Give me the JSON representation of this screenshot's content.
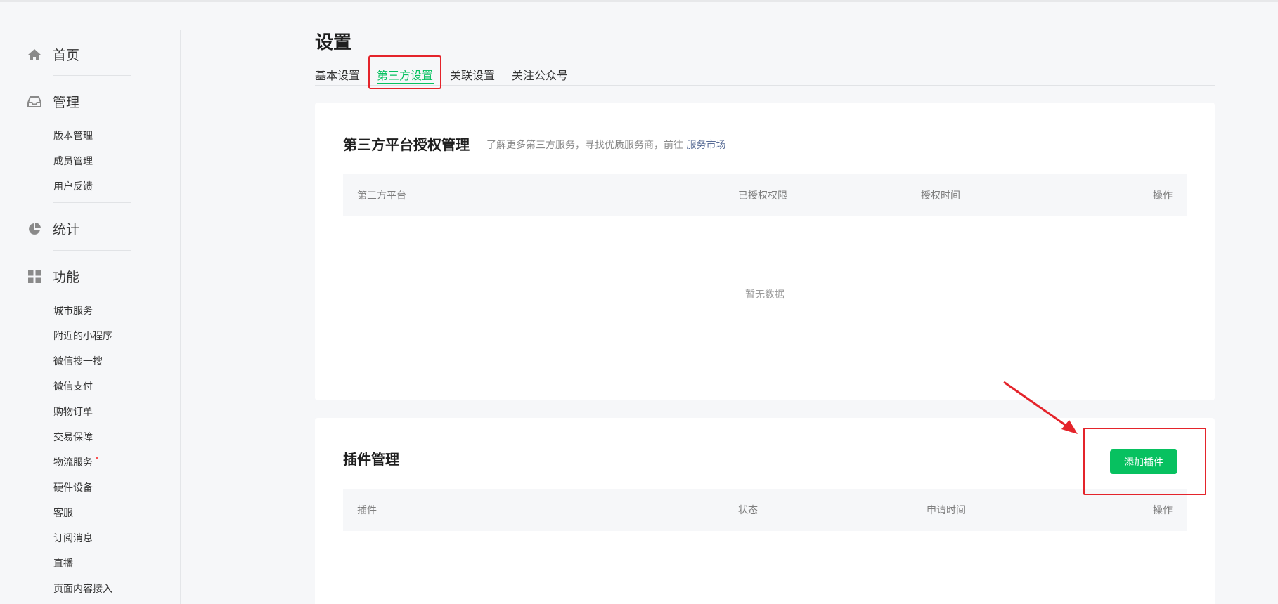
{
  "sidebar": {
    "groups": [
      {
        "label": "首页",
        "icon": "home-icon"
      },
      {
        "label": "管理",
        "icon": "inbox-icon"
      },
      {
        "label": "统计",
        "icon": "pie-chart-icon"
      },
      {
        "label": "功能",
        "icon": "grid-icon"
      }
    ],
    "manage_items": [
      "版本管理",
      "成员管理",
      "用户反馈"
    ],
    "feature_items": [
      "城市服务",
      "附近的小程序",
      "微信搜一搜",
      "微信支付",
      "购物订单",
      "交易保障",
      "物流服务",
      "硬件设备",
      "客服",
      "订阅消息",
      "直播",
      "页面内容接入"
    ]
  },
  "page": {
    "title": "设置",
    "tabs": [
      "基本设置",
      "第三方设置",
      "关联设置",
      "关注公众号"
    ],
    "active_tab": "第三方设置"
  },
  "third_party": {
    "title": "第三方平台授权管理",
    "desc_text": "了解更多第三方服务，寻找优质服务商，前往",
    "desc_link": "服务市场",
    "columns": [
      "第三方平台",
      "已授权权限",
      "授权时间",
      "操作"
    ],
    "empty_text": "暂无数据"
  },
  "plugins": {
    "title": "插件管理",
    "add_button": "添加插件",
    "columns": [
      "插件",
      "状态",
      "申请时间",
      "操作"
    ]
  },
  "colors": {
    "accent": "#07c160",
    "highlight": "#e4242b",
    "link": "#576b95",
    "badge_dot": "#fa5151"
  }
}
